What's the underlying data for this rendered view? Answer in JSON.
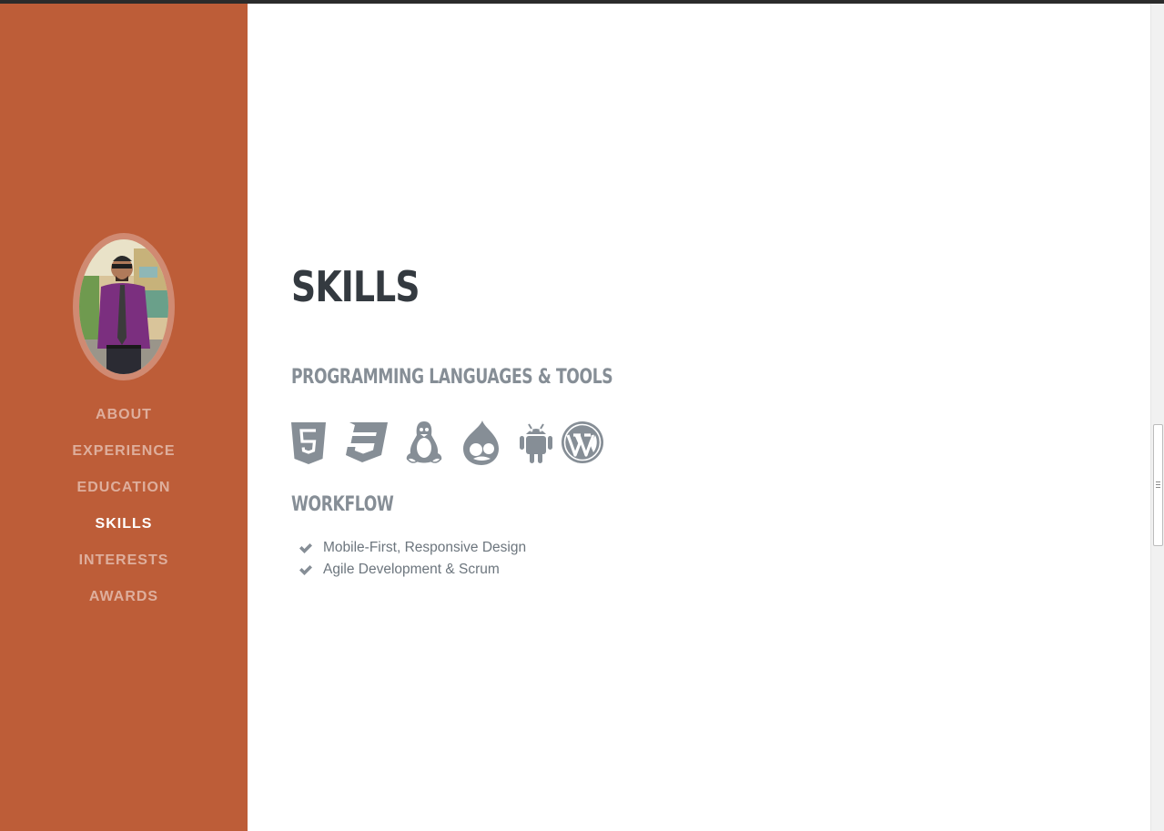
{
  "sidebar": {
    "avatar_alt": "profile photo",
    "nav": [
      {
        "label": "ABOUT",
        "active": false
      },
      {
        "label": "EXPERIENCE",
        "active": false
      },
      {
        "label": "EDUCATION",
        "active": false
      },
      {
        "label": "SKILLS",
        "active": true
      },
      {
        "label": "INTERESTS",
        "active": false
      },
      {
        "label": "AWARDS",
        "active": false
      }
    ]
  },
  "main": {
    "title": "SKILLS",
    "tools_heading": "PROGRAMMING LANGUAGES & TOOLS",
    "tool_icons": [
      "html5-icon",
      "css3-icon",
      "linux-icon",
      "drupal-icon",
      "android-icon",
      "wordpress-icon"
    ],
    "workflow_heading": "WORKFLOW",
    "workflow_items": [
      "Mobile-First, Responsive Design",
      "Agile Development & Scrum"
    ]
  },
  "colors": {
    "sidebar_bg": "#bd5d38",
    "title": "#343a40",
    "muted": "#868e96"
  }
}
